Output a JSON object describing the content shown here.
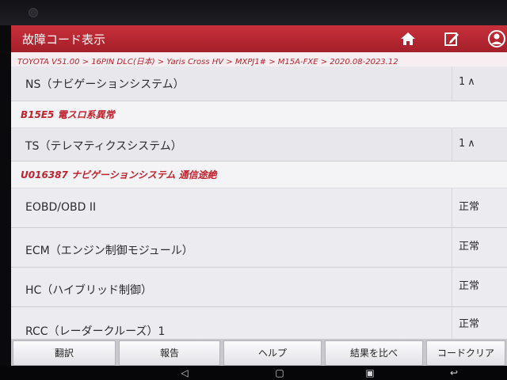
{
  "header": {
    "title": "故障コード表示"
  },
  "breadcrumb": "TOYOTA V51.00 > 16PIN DLC(日本) > Yaris Cross HV > MXPJ1# > M15A-FXE > 2020.08-2023.12",
  "rows": [
    {
      "kind": "sys",
      "name": "NS（ナビゲーションシステム）",
      "status": "1",
      "chevron": "∧"
    },
    {
      "kind": "dtc",
      "code": "B15E5 電スロ系異常"
    },
    {
      "kind": "sys",
      "name": "TS（テレマティクスシステム）",
      "status": "1",
      "chevron": "∧"
    },
    {
      "kind": "dtc",
      "code": "U016387 ナビゲーションシステム 通信途絶"
    },
    {
      "kind": "ecu",
      "name": "EOBD/OBD II",
      "status": "正常"
    },
    {
      "kind": "ecu",
      "name": "ECM（エンジン制御モジュール）",
      "status": "正常"
    },
    {
      "kind": "ecu",
      "name": "HC（ハイブリッド制御）",
      "status": "正常"
    },
    {
      "kind": "ecu",
      "name": "RCC（レーダークルーズ）1",
      "status": "正常"
    }
  ],
  "buttons": [
    "翻訳",
    "報告",
    "ヘルプ",
    "結果を比べ",
    "コードクリア"
  ],
  "colors": {
    "titlebar": "#b0222d",
    "dtc_text": "#c0232d"
  }
}
